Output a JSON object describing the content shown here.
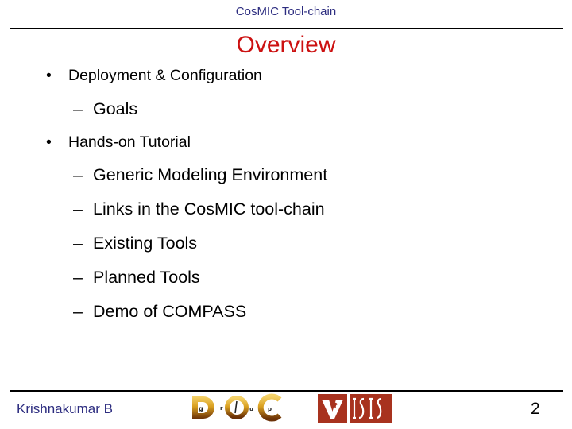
{
  "header": {
    "title": "CosMIC Tool-chain"
  },
  "slide": {
    "title": "Overview",
    "outline": [
      {
        "level": 1,
        "marker": "•",
        "text": "Deployment & Configuration"
      },
      {
        "level": 2,
        "marker": "–",
        "text": "Goals"
      },
      {
        "level": 1,
        "marker": "•",
        "text": "Hands-on Tutorial"
      },
      {
        "level": 2,
        "marker": "–",
        "text": "Generic Modeling Environment"
      },
      {
        "level": 2,
        "marker": "–",
        "text": "Links in the CosMIC tool-chain"
      },
      {
        "level": 2,
        "marker": "–",
        "text": "Existing Tools"
      },
      {
        "level": 2,
        "marker": "–",
        "text": "Planned Tools"
      },
      {
        "level": 2,
        "marker": "–",
        "text": "Demo of COMPASS"
      }
    ]
  },
  "footer": {
    "author": "Krishnakumar B",
    "page_number": "2",
    "logos": [
      {
        "name": "doc-group-logo",
        "letters": [
          "D",
          "g",
          "r",
          "O",
          "u",
          "C",
          "p"
        ],
        "label": "DOC group"
      },
      {
        "name": "vanderbilt-isis-logo",
        "text": "ISIS",
        "mark": "V"
      }
    ]
  },
  "colors": {
    "header_text": "#2d2d80",
    "title_text": "#cc1111",
    "body_text": "#000000",
    "logo_gold": "#d9a020",
    "logo_dark": "#7a3a08",
    "isis_red": "#a8321e"
  }
}
